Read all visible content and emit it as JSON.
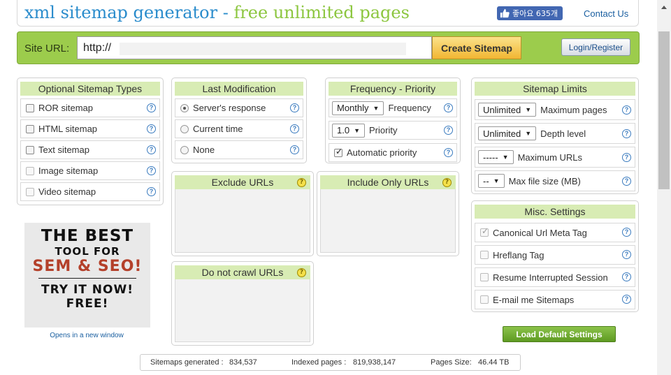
{
  "header": {
    "logo_part1": "xml sitemap generator - ",
    "logo_part2": "free unlimited pages",
    "like_label": "좋아요 635개",
    "contact": "Contact Us"
  },
  "urlbar": {
    "label": "Site URL:",
    "value": "http://",
    "create": "Create Sitemap",
    "login": "Login/Register"
  },
  "types": {
    "title": "Optional Sitemap Types",
    "items": [
      "ROR sitemap",
      "HTML sitemap",
      "Text sitemap",
      "Image sitemap",
      "Video sitemap"
    ]
  },
  "lastmod": {
    "title": "Last Modification",
    "items": [
      "Server's response",
      "Current time",
      "None"
    ]
  },
  "freq": {
    "title": "Frequency - Priority",
    "frequency_value": "Monthly",
    "frequency_label": "Frequency",
    "priority_value": "1.0",
    "priority_label": "Priority",
    "auto_label": "Automatic priority"
  },
  "limits": {
    "title": "Sitemap Limits",
    "max_pages_value": "Unlimited",
    "max_pages_label": "Maximum pages",
    "depth_value": "Unlimited",
    "depth_label": "Depth level",
    "max_urls_value": "-----",
    "max_urls_label": "Maximum URLs",
    "file_size_value": "--",
    "file_size_label": "Max file size (MB)"
  },
  "exclude": {
    "title": "Exclude URLs"
  },
  "include": {
    "title": "Include Only URLs"
  },
  "nocrawl": {
    "title": "Do not crawl URLs"
  },
  "misc": {
    "title": "Misc. Settings",
    "items": [
      "Canonical Url Meta Tag",
      "Hreflang Tag",
      "Resume Interrupted Session",
      "E-mail me Sitemaps"
    ]
  },
  "ad": {
    "line1": "THE BEST",
    "line2": "TOOL FOR",
    "line3": "SEM & SEO!",
    "line4": "TRY IT NOW!",
    "line5": "FREE!",
    "link": "Opens in a new window"
  },
  "load_default": "Load Default Settings",
  "stats": {
    "generated_label": "Sitemaps generated :",
    "generated_value": "834,537",
    "indexed_label": "Indexed pages :",
    "indexed_value": "819,938,147",
    "size_label": "Pages Size:",
    "size_value": "46.44 TB"
  },
  "help_glyph": "?",
  "colors": {
    "blue": "#2a8ccc",
    "green": "#8cc63f",
    "bar": "#9ccc4c"
  }
}
